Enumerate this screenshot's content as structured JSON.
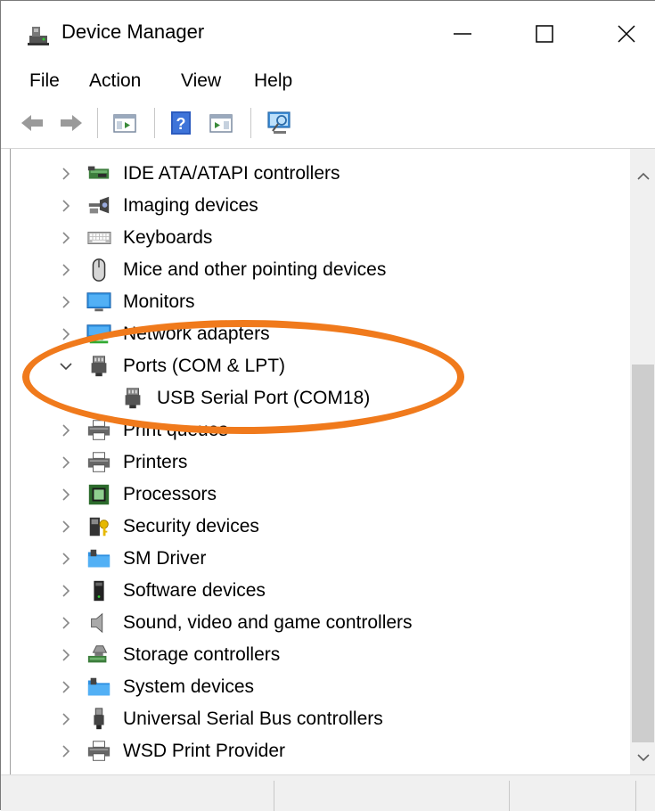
{
  "window": {
    "title": "Device Manager",
    "icon": "device-manager-icon"
  },
  "controls": {
    "minimize": "—",
    "maximize": "☐",
    "close": "✕"
  },
  "menu": {
    "file": "File",
    "action": "Action",
    "view": "View",
    "help": "Help"
  },
  "toolbar": {
    "buttons": [
      "back-icon",
      "forward-icon",
      "show-hide-console-tree-icon",
      "help-icon",
      "show-hide-action-pane-icon",
      "scan-hardware-icon"
    ]
  },
  "tree": {
    "items": [
      {
        "label": "IDE ATA/ATAPI controllers",
        "icon": "ide-controller-icon",
        "expanded": false
      },
      {
        "label": "Imaging devices",
        "icon": "camera-icon",
        "expanded": false
      },
      {
        "label": "Keyboards",
        "icon": "keyboard-icon",
        "expanded": false
      },
      {
        "label": "Mice and other pointing devices",
        "icon": "mouse-icon",
        "expanded": false
      },
      {
        "label": "Monitors",
        "icon": "monitor-icon",
        "expanded": false
      },
      {
        "label": "Network adapters",
        "icon": "network-adapter-icon",
        "expanded": false
      },
      {
        "label": "Ports (COM & LPT)",
        "icon": "port-icon",
        "expanded": true
      },
      {
        "label": "USB Serial Port (COM18)",
        "icon": "port-icon",
        "child": true
      },
      {
        "label": "Print queues",
        "icon": "printer-icon",
        "expanded": false
      },
      {
        "label": "Printers",
        "icon": "printer-icon",
        "expanded": false
      },
      {
        "label": "Processors",
        "icon": "processor-icon",
        "expanded": false
      },
      {
        "label": "Security devices",
        "icon": "security-device-icon",
        "expanded": false
      },
      {
        "label": "SM Driver",
        "icon": "system-folder-icon",
        "expanded": false
      },
      {
        "label": "Software devices",
        "icon": "software-device-icon",
        "expanded": false
      },
      {
        "label": "Sound, video and game controllers",
        "icon": "speaker-icon",
        "expanded": false
      },
      {
        "label": "Storage controllers",
        "icon": "storage-controller-icon",
        "expanded": false
      },
      {
        "label": "System devices",
        "icon": "system-folder-icon",
        "expanded": false
      },
      {
        "label": "Universal Serial Bus controllers",
        "icon": "usb-icon",
        "expanded": false
      },
      {
        "label": "WSD Print Provider",
        "icon": "printer-icon",
        "expanded": false
      }
    ]
  },
  "colors": {
    "highlight": "#f07a1c",
    "accent": "#0078d7"
  }
}
